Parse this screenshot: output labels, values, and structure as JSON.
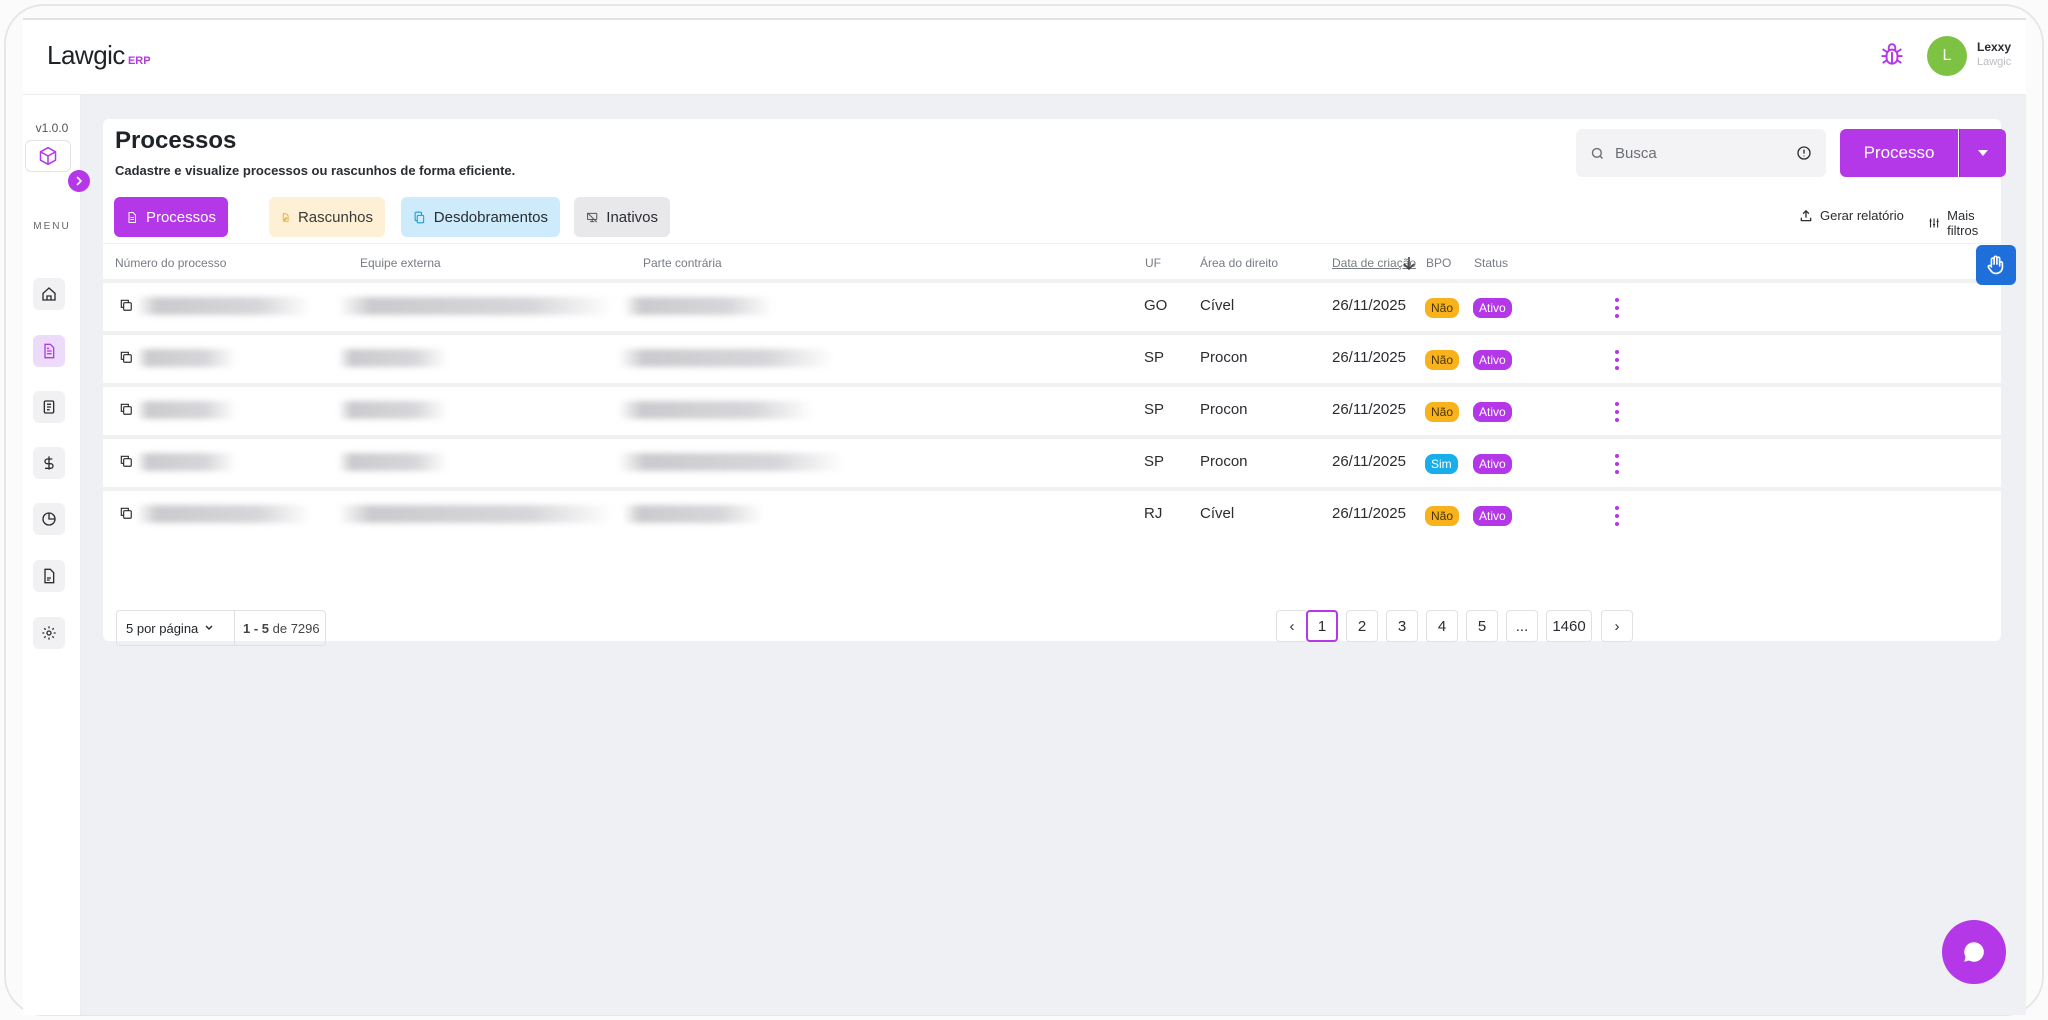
{
  "app": {
    "logo_main": "Lawgic",
    "logo_sub": "ERP",
    "version": "v1.0.0",
    "menu_label": "MENU",
    "colors": {
      "accent": "#b437e8",
      "warning": "#f7b21c",
      "info": "#19aee9"
    }
  },
  "user": {
    "initial": "L",
    "name": "Lexxy",
    "org": "Lawgic"
  },
  "sidebar": {
    "items": [
      {
        "icon": "home-icon"
      },
      {
        "icon": "document-icon",
        "active": true
      },
      {
        "icon": "notebook-icon"
      },
      {
        "icon": "dollar-icon"
      },
      {
        "icon": "pie-chart-icon"
      },
      {
        "icon": "file-pdf-icon"
      },
      {
        "icon": "gear-icon"
      }
    ]
  },
  "header": {
    "title": "Processos",
    "subtitle": "Cadastre e visualize processos ou rascunhos de forma eficiente.",
    "search_placeholder": "Busca",
    "primary_button": "Processo",
    "report_link": "Gerar relatório",
    "filters_link": "Mais filtros"
  },
  "tabs": [
    {
      "label": "Processos"
    },
    {
      "label": "Rascunhos"
    },
    {
      "label": "Desdobramentos"
    },
    {
      "label": "Inativos"
    }
  ],
  "table": {
    "columns": [
      "Número do processo",
      "Equipe externa",
      "Parte contrária",
      "UF",
      "Área do direito",
      "Data de criação",
      "BPO",
      "Status"
    ],
    "rows": [
      {
        "uf": "GO",
        "area": "Cível",
        "date": "26/11/2025",
        "bpo": "Não",
        "status": "Ativo"
      },
      {
        "uf": "SP",
        "area": "Procon",
        "date": "26/11/2025",
        "bpo": "Não",
        "status": "Ativo"
      },
      {
        "uf": "SP",
        "area": "Procon",
        "date": "26/11/2025",
        "bpo": "Não",
        "status": "Ativo"
      },
      {
        "uf": "SP",
        "area": "Procon",
        "date": "26/11/2025",
        "bpo": "Sim",
        "status": "Ativo"
      },
      {
        "uf": "RJ",
        "area": "Cível",
        "date": "26/11/2025",
        "bpo": "Não",
        "status": "Ativo"
      }
    ]
  },
  "pagination": {
    "per_page_label": "5 por página",
    "range_bold": "1 - 5",
    "range_rest": " de 7296",
    "pages": [
      "1",
      "2",
      "3",
      "4",
      "5",
      "...",
      "1460"
    ],
    "prev": "‹",
    "next": "›"
  }
}
